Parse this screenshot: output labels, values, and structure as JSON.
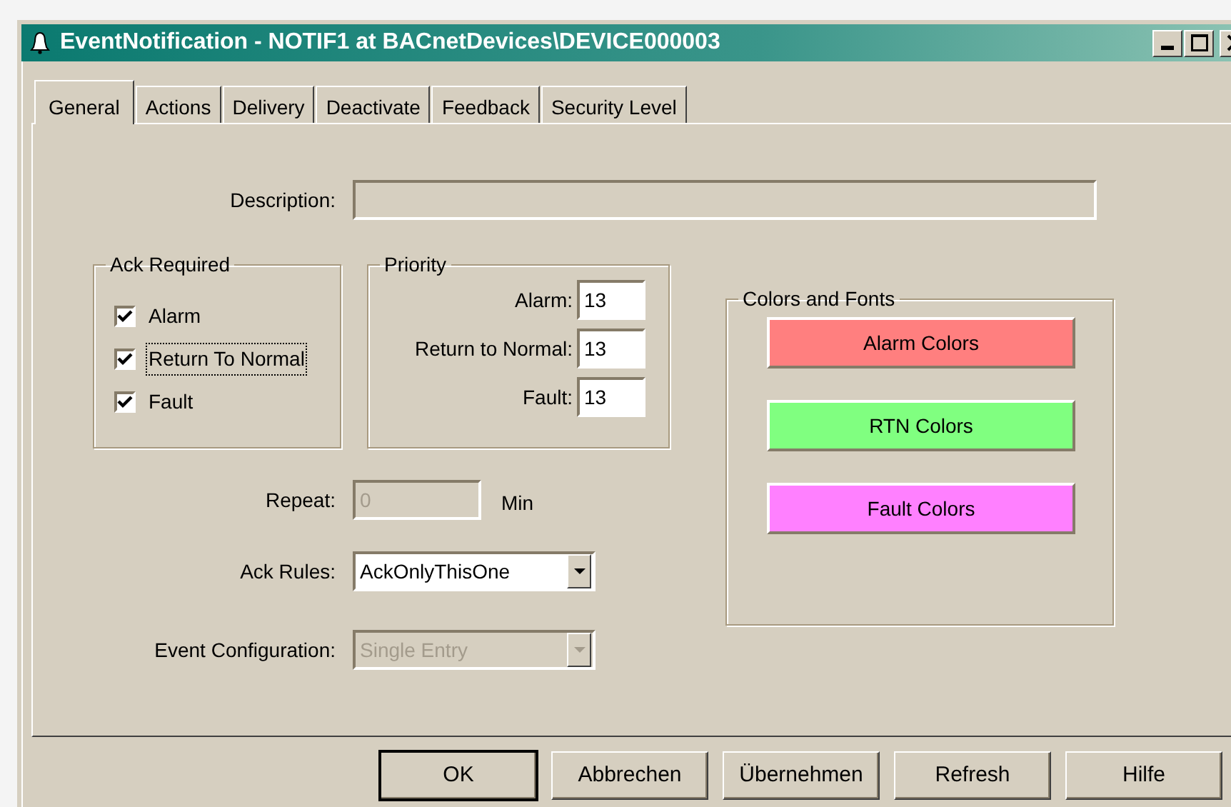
{
  "window": {
    "title": "EventNotification - NOTIF1 at BACnetDevices\\DEVICE000003"
  },
  "tabs": [
    {
      "label": "General",
      "selected": true
    },
    {
      "label": "Actions",
      "selected": false
    },
    {
      "label": "Delivery",
      "selected": false
    },
    {
      "label": "Deactivate",
      "selected": false
    },
    {
      "label": "Feedback",
      "selected": false
    },
    {
      "label": "Security Level",
      "selected": false
    }
  ],
  "description": {
    "label": "Description:"
  },
  "ack_required": {
    "title": "Ack Required",
    "items": [
      {
        "label": "Alarm",
        "checked": true,
        "focused": false
      },
      {
        "label": "Return To Normal",
        "checked": true,
        "focused": true
      },
      {
        "label": "Fault",
        "checked": true,
        "focused": false
      }
    ]
  },
  "priority": {
    "title": "Priority",
    "fields": [
      {
        "label": "Alarm:",
        "value": "13"
      },
      {
        "label": "Return to Normal:",
        "value": "13"
      },
      {
        "label": "Fault:",
        "value": "13"
      }
    ]
  },
  "repeat": {
    "label": "Repeat:",
    "value": "0",
    "unit": "Min",
    "disabled": true
  },
  "ack_rules": {
    "label": "Ack Rules:",
    "value": "AckOnlyThisOne",
    "disabled": false
  },
  "event_configuration": {
    "label": "Event Configuration:",
    "value": "Single Entry",
    "disabled": true
  },
  "colors_and_fonts": {
    "title": "Colors and Fonts",
    "buttons": [
      {
        "label": "Alarm Colors",
        "color": "#ff7f7f"
      },
      {
        "label": "RTN Colors",
        "color": "#80ff80"
      },
      {
        "label": "Fault Colors",
        "color": "#ff80ff"
      }
    ]
  },
  "buttons": [
    {
      "label": "OK",
      "default": true
    },
    {
      "label": "Abbrechen",
      "default": false
    },
    {
      "label": "Übernehmen",
      "default": false
    },
    {
      "label": "Refresh",
      "default": false
    },
    {
      "label": "Hilfe",
      "default": false
    }
  ]
}
